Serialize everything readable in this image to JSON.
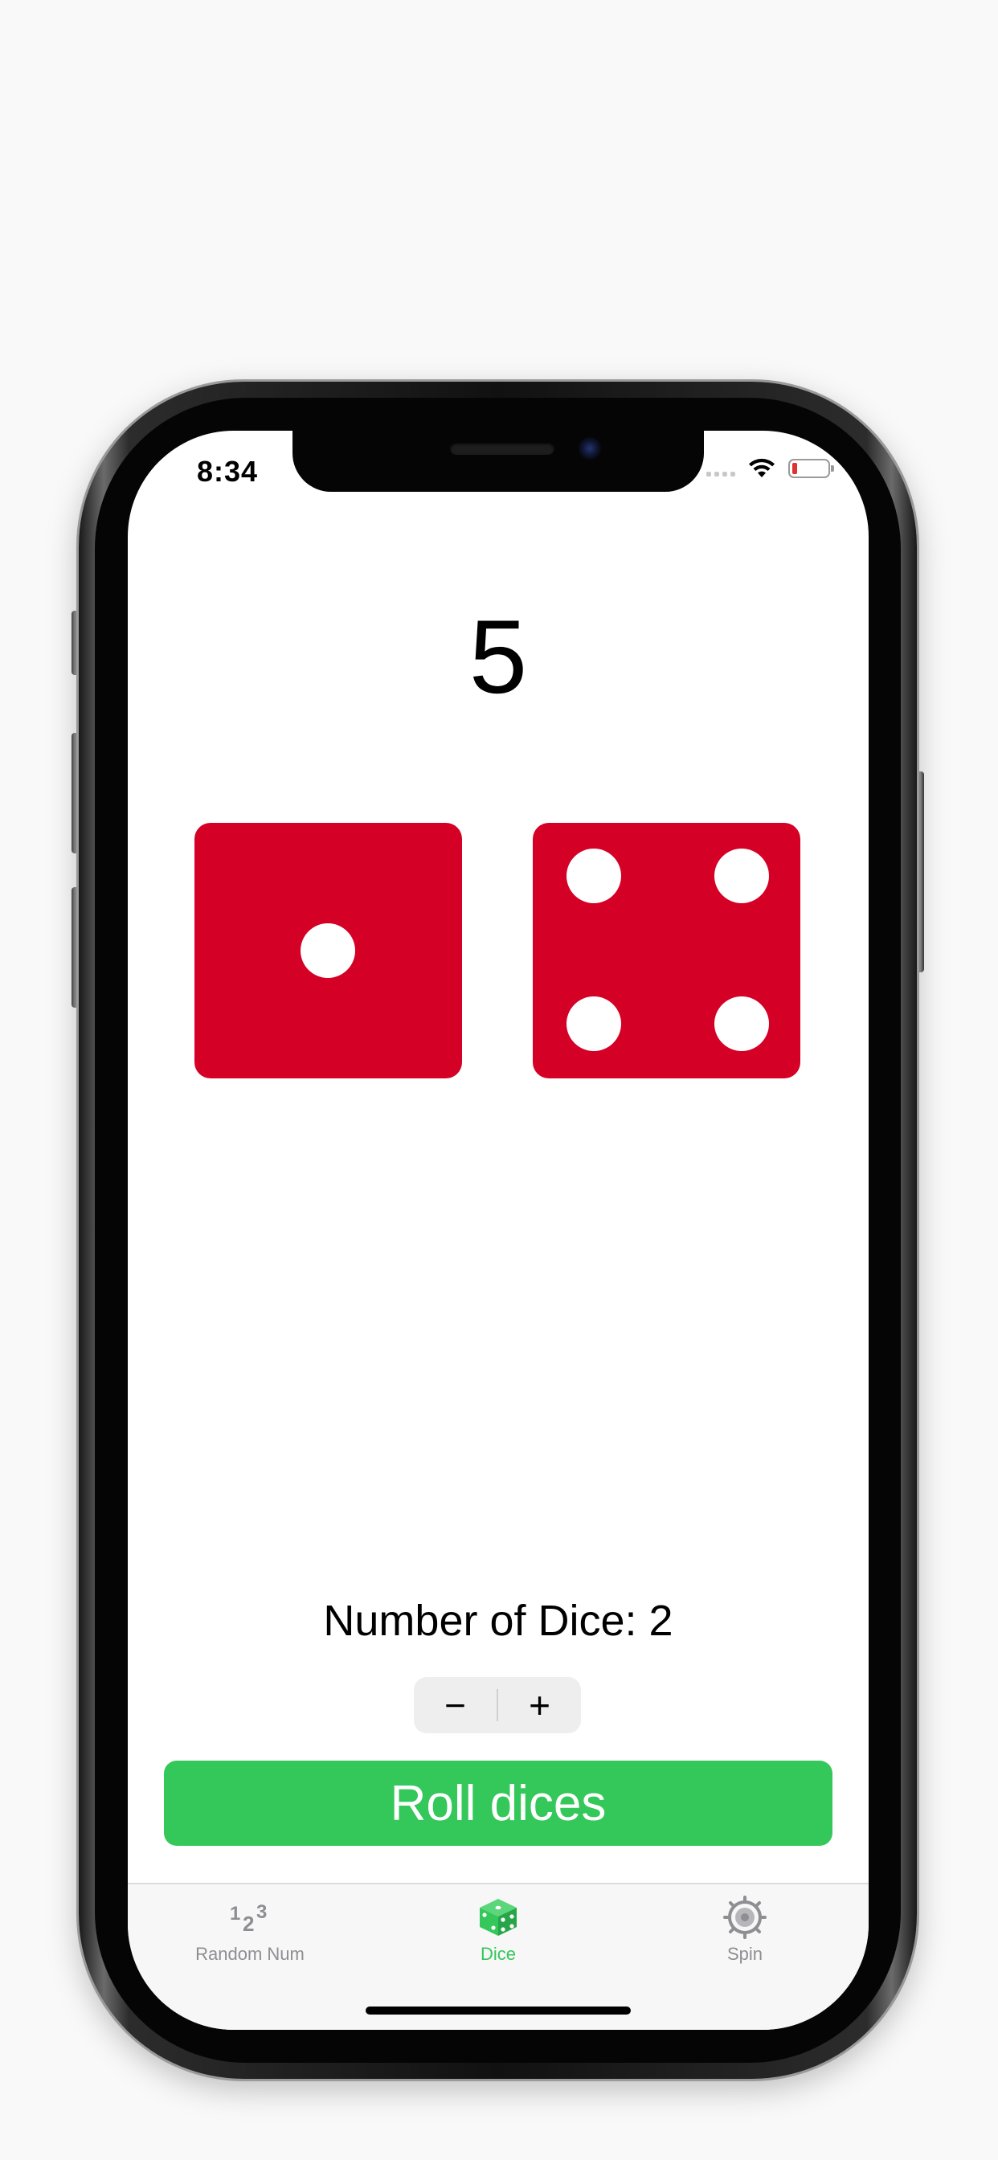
{
  "status_bar": {
    "time": "8:34",
    "battery_color": "#e0332f"
  },
  "dice_view": {
    "total": "5",
    "dice": [
      {
        "value": 1
      },
      {
        "value": 4
      }
    ],
    "die_color": "#d50025",
    "pip_color": "#ffffff",
    "count_label": "Number of Dice: 2",
    "stepper": {
      "minus_label": "−",
      "plus_label": "+"
    },
    "roll_button_label": "Roll dices",
    "roll_button_color": "#34c759"
  },
  "tab_bar": {
    "items": [
      {
        "label": "Random Num",
        "icon": "numbers-123-icon",
        "active": false
      },
      {
        "label": "Dice",
        "icon": "dice-icon",
        "active": true
      },
      {
        "label": "Spin",
        "icon": "spin-wheel-icon",
        "active": false
      }
    ],
    "active_color": "#34c759",
    "inactive_color": "#8e8e93"
  }
}
